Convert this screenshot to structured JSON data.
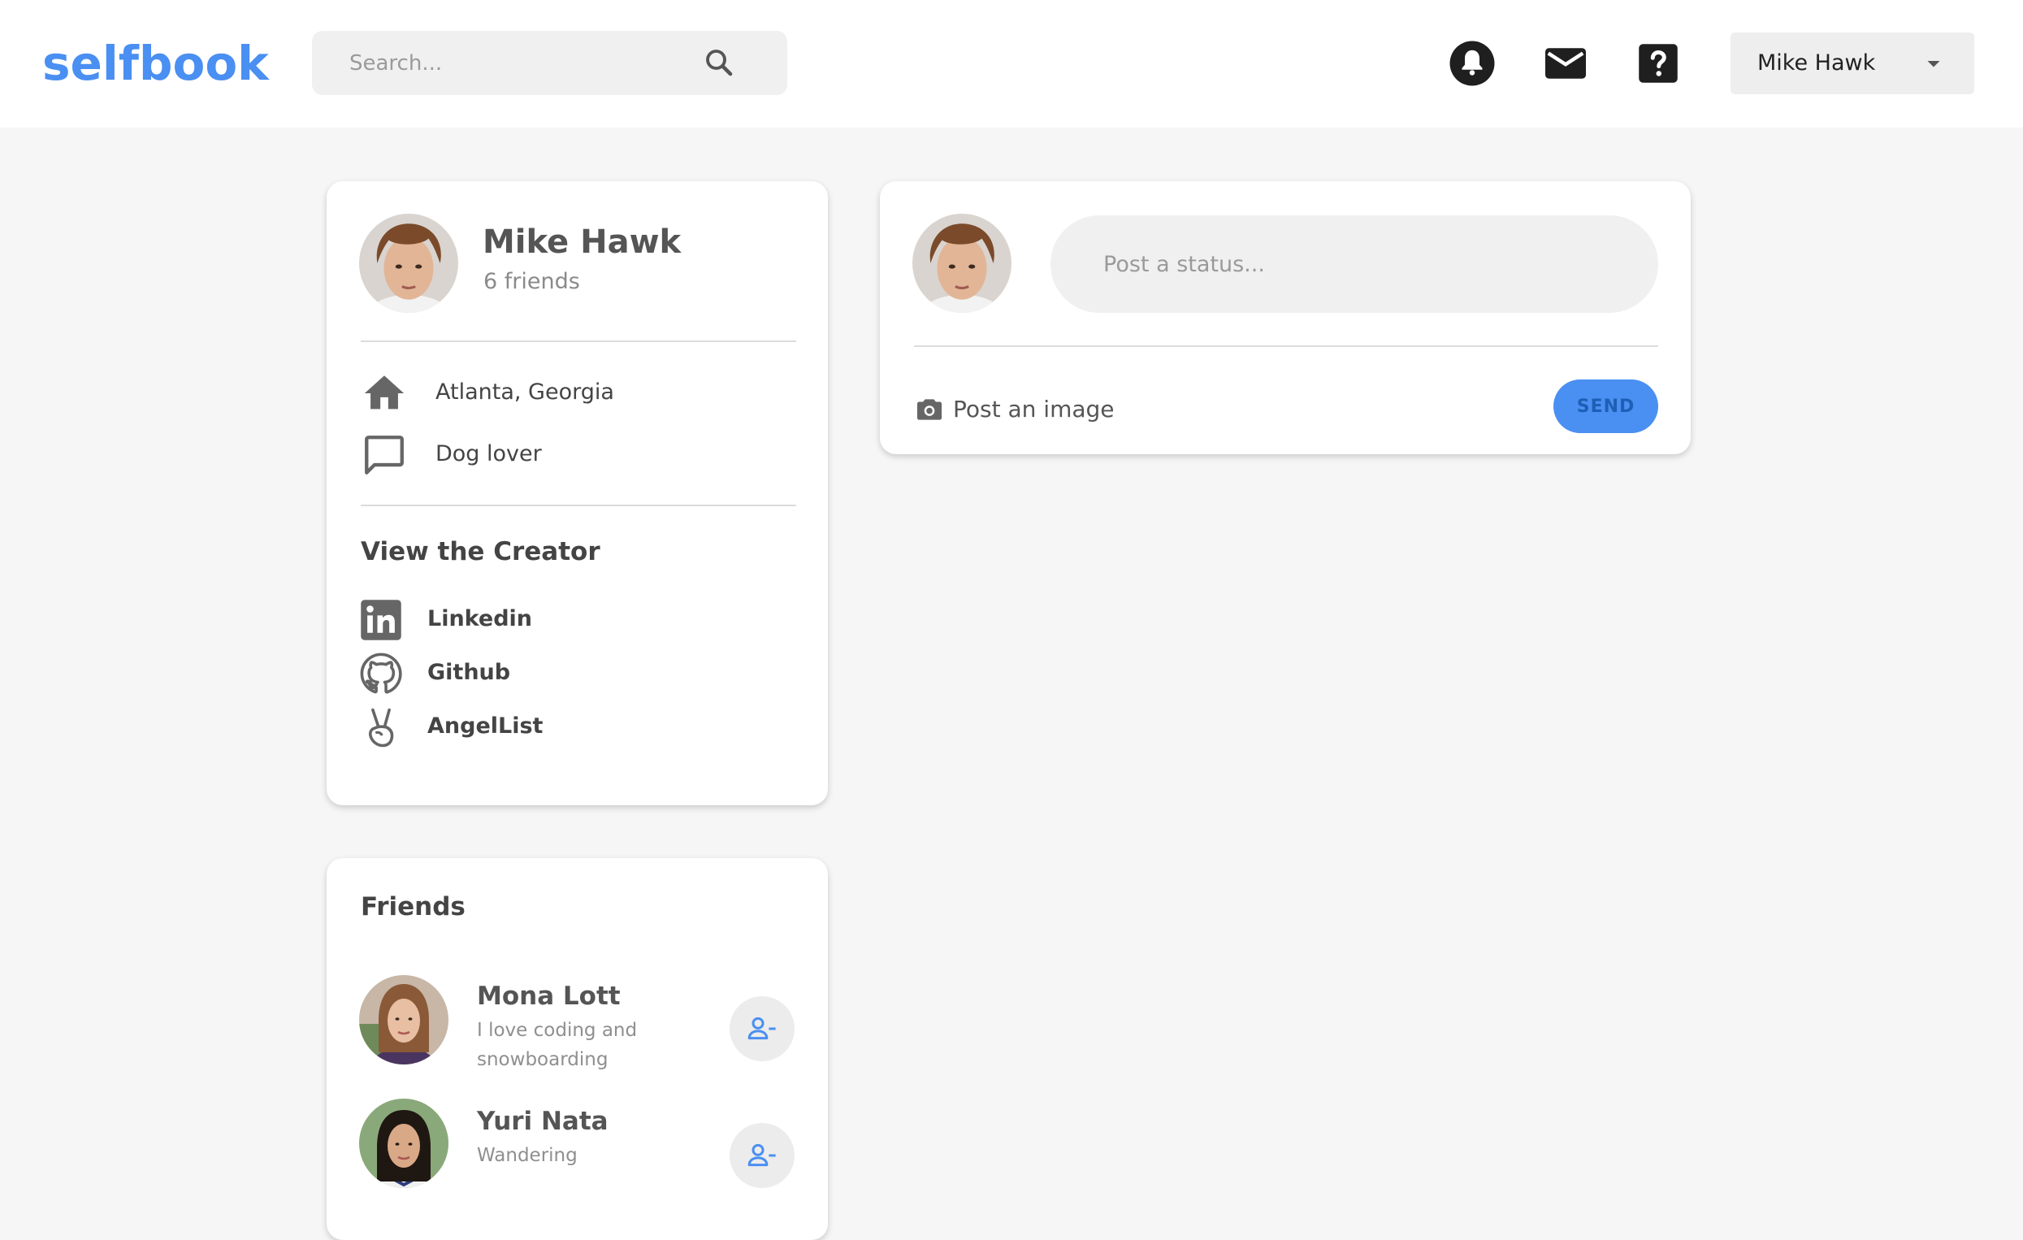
{
  "brand": {
    "logo": "selfbook",
    "color": "#4a8ff2"
  },
  "header": {
    "search_placeholder": "Search...",
    "icons": [
      "notifications-icon",
      "mail-icon",
      "help-icon"
    ],
    "user_menu": {
      "name": "Mike Hawk"
    }
  },
  "profile": {
    "name": "Mike Hawk",
    "friends_count": "6 friends",
    "location": "Atlanta, Georgia",
    "bio": "Dog lover",
    "creator_title": "View the Creator",
    "links": [
      {
        "label": "Linkedin",
        "icon": "linkedin-icon"
      },
      {
        "label": "Github",
        "icon": "github-icon"
      },
      {
        "label": "AngelList",
        "icon": "angellist-icon"
      }
    ]
  },
  "friends": {
    "title": "Friends",
    "items": [
      {
        "name": "Mona Lott",
        "description": "I love coding and snowboarding"
      },
      {
        "name": "Yuri Nata",
        "description": "Wandering"
      }
    ]
  },
  "post": {
    "placeholder": "Post a status...",
    "image_label": "Post an image",
    "send_label": "SEND"
  }
}
